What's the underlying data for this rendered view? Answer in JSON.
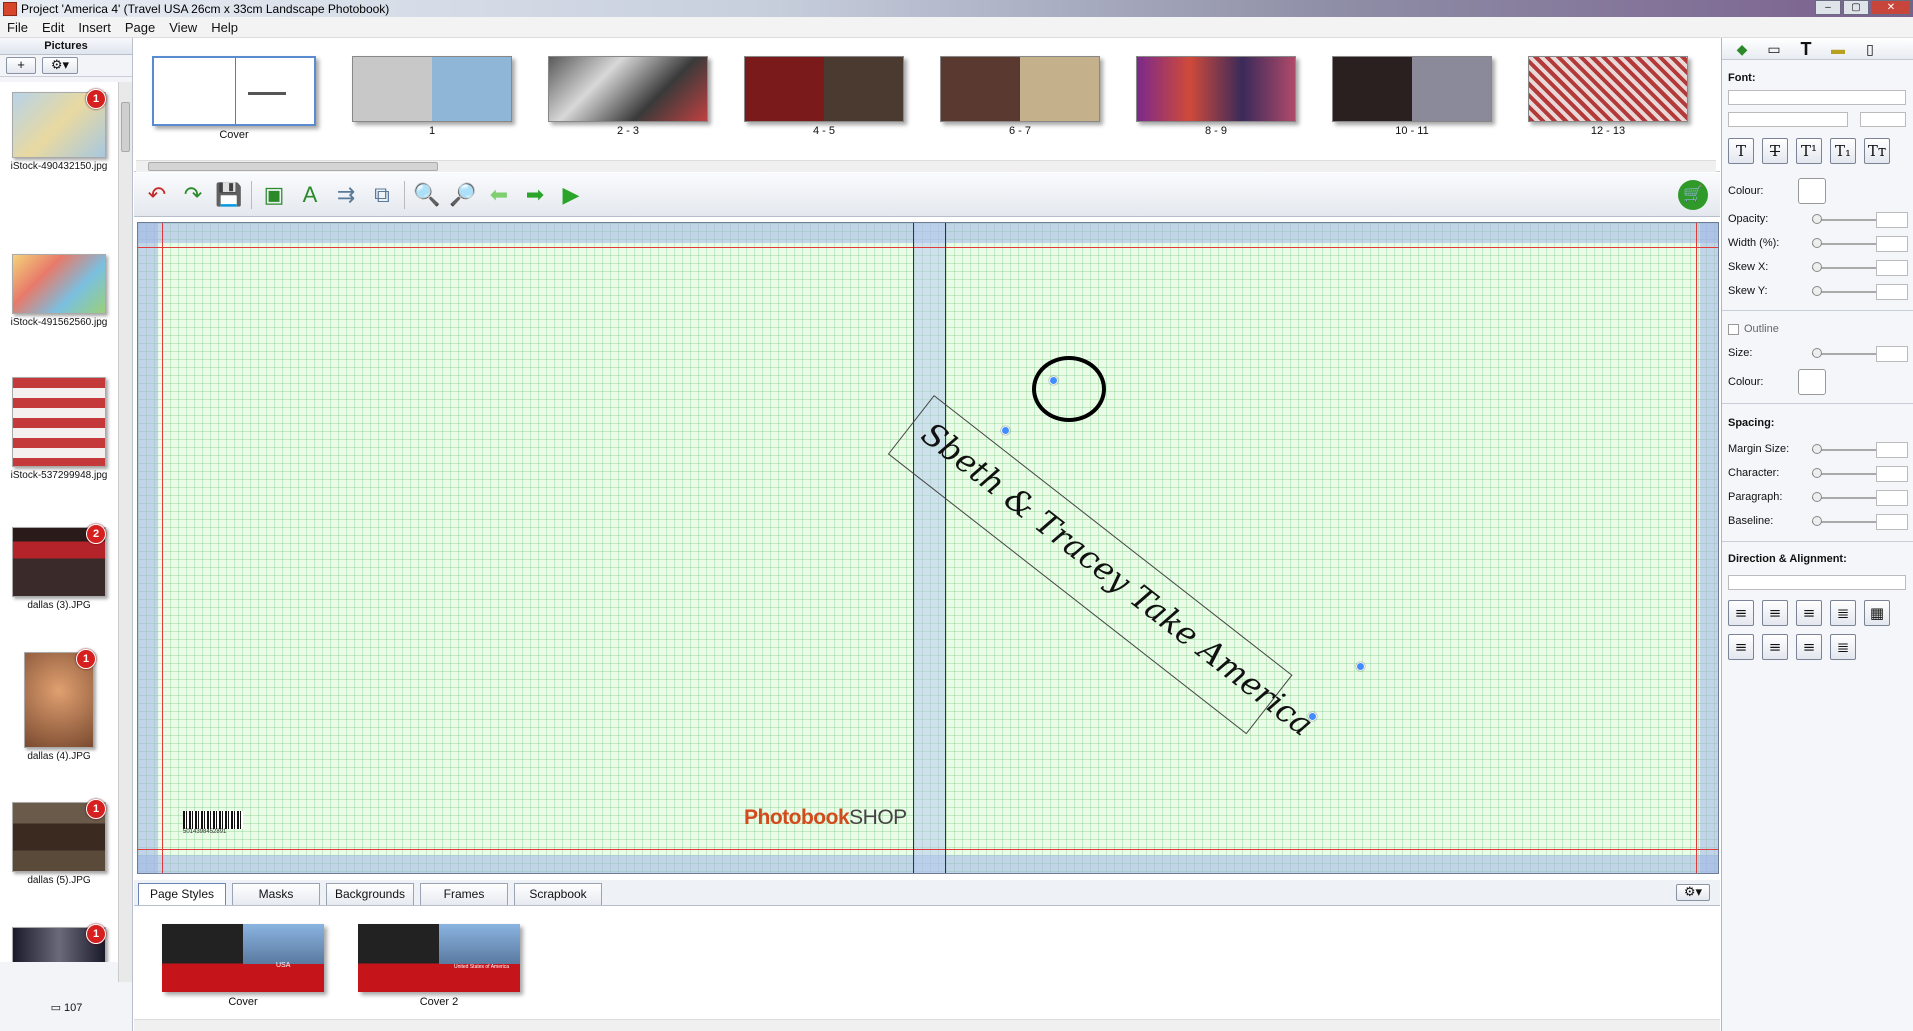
{
  "window": {
    "title": "Project 'America 4' (Travel USA 26cm x 33cm Landscape Photobook)"
  },
  "menu": [
    "File",
    "Edit",
    "Insert",
    "Page",
    "View",
    "Help"
  ],
  "pictures_panel": {
    "title": "Pictures",
    "add_label": "+",
    "items": [
      {
        "name": "iStock-490432150.jpg",
        "badge": "1",
        "color": "#8fb6d6"
      },
      {
        "name": "iStock-491562560.jpg",
        "badge": "",
        "color": "#e9c37a"
      },
      {
        "name": "iStock-537299948.jpg",
        "badge": "",
        "color": "#c84a4a"
      },
      {
        "name": "dallas (3).JPG",
        "badge": "2",
        "color": "#7a2020"
      },
      {
        "name": "dallas (4).JPG",
        "badge": "1",
        "color": "#b07a50"
      },
      {
        "name": "dallas (5).JPG",
        "badge": "1",
        "color": "#5a4a3a"
      },
      {
        "name": "",
        "badge": "1",
        "color": "#2a2a40"
      }
    ],
    "count": "107"
  },
  "pages": [
    {
      "label": "Cover",
      "color": "#ffffff"
    },
    {
      "label": "1",
      "color": "#8fb6d6"
    },
    {
      "label": "2 - 3",
      "color": "#4a4a4a"
    },
    {
      "label": "4 - 5",
      "color": "#7a1a1a"
    },
    {
      "label": "6 - 7",
      "color": "#8a7050"
    },
    {
      "label": "8 - 9",
      "color": "#9a2a6a"
    },
    {
      "label": "10 - 11",
      "color": "#3a3030"
    },
    {
      "label": "12 - 13",
      "color": "#b43a3a"
    }
  ],
  "canvas": {
    "text": "Sbeth & Tracey Take America",
    "logo_main": "Photobook",
    "logo_tail": "SHOP",
    "barcode_text": "5014398452891"
  },
  "bottom_tabs": [
    "Page Styles",
    "Masks",
    "Backgrounds",
    "Frames",
    "Scrapbook"
  ],
  "styles": [
    {
      "label": "Cover",
      "tag": "USA"
    },
    {
      "label": "Cover 2",
      "tag": "United States of America"
    }
  ],
  "props": {
    "font_label": "Font:",
    "colour_label": "Colour:",
    "opacity_label": "Opacity:",
    "width_label": "Width (%):",
    "skewx_label": "Skew X:",
    "skewy_label": "Skew Y:",
    "outline_label": "Outline",
    "size_label": "Size:",
    "colour2_label": "Colour:",
    "spacing_label": "Spacing:",
    "margin_label": "Margin Size:",
    "character_label": "Character:",
    "paragraph_label": "Paragraph:",
    "baseline_label": "Baseline:",
    "direction_label": "Direction & Alignment:"
  }
}
